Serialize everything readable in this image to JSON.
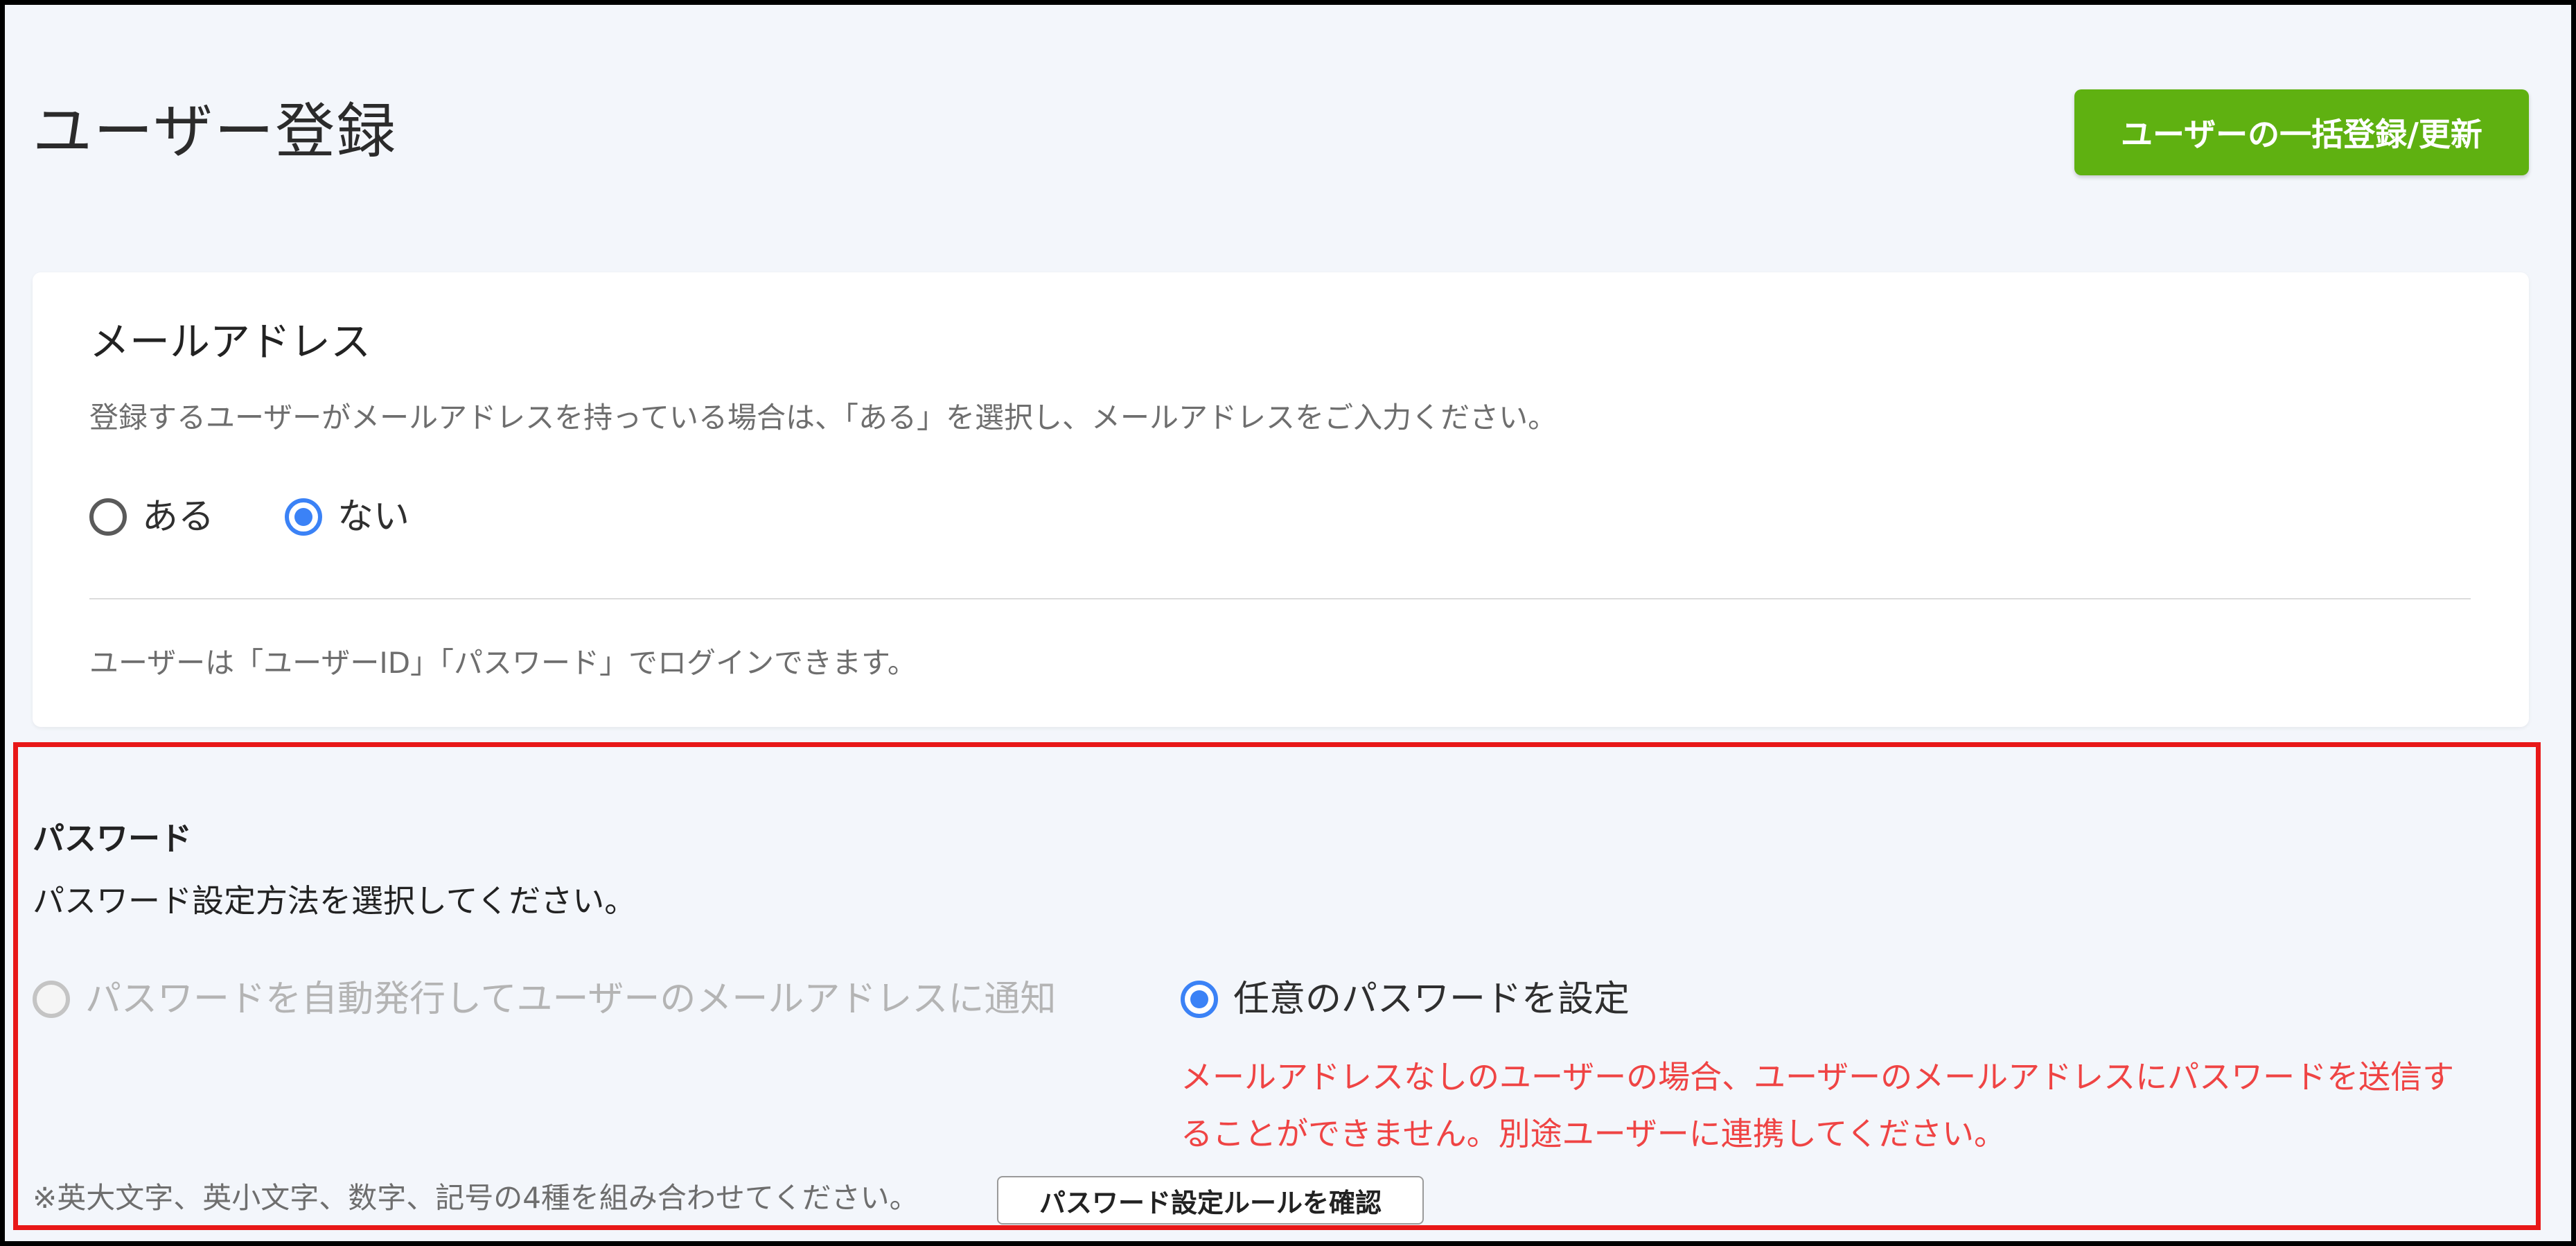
{
  "page": {
    "title": "ユーザー登録",
    "bulk_button_label": "ユーザーの一括登録/更新"
  },
  "email_section": {
    "heading": "メールアドレス",
    "description": "登録するユーザーがメールアドレスを持っている場合は、「ある」を選択し、メールアドレスをご入力ください。",
    "options": [
      {
        "label": "ある",
        "selected": false
      },
      {
        "label": "ない",
        "selected": true
      }
    ],
    "note": "ユーザーは「ユーザーID」「パスワード」でログインできます。"
  },
  "password_section": {
    "heading": "パスワード",
    "description": "パスワード設定方法を選択してください。",
    "options": [
      {
        "label": "パスワードを自動発行してユーザーのメールアドレスに通知",
        "selected": false,
        "disabled": true
      },
      {
        "label": "任意のパスワードを設定",
        "selected": true,
        "disabled": false
      }
    ],
    "warning_line1": "メールアドレスなしのユーザーの場合、ユーザーのメールアドレスにパスワードを送信す",
    "warning_line2": "ることができません。別途ユーザーに連携してください。",
    "rule_note": "※英大文字、英小文字、数字、記号の4種を組み合わせてください。",
    "rule_button_label": "パスワード設定ルールを確認"
  },
  "colors": {
    "primary_green": "#5fb111",
    "radio_blue": "#3b82f6",
    "warning_red": "#ef4444",
    "highlight_red": "#e81818",
    "page_background": "#f3f6fb"
  }
}
